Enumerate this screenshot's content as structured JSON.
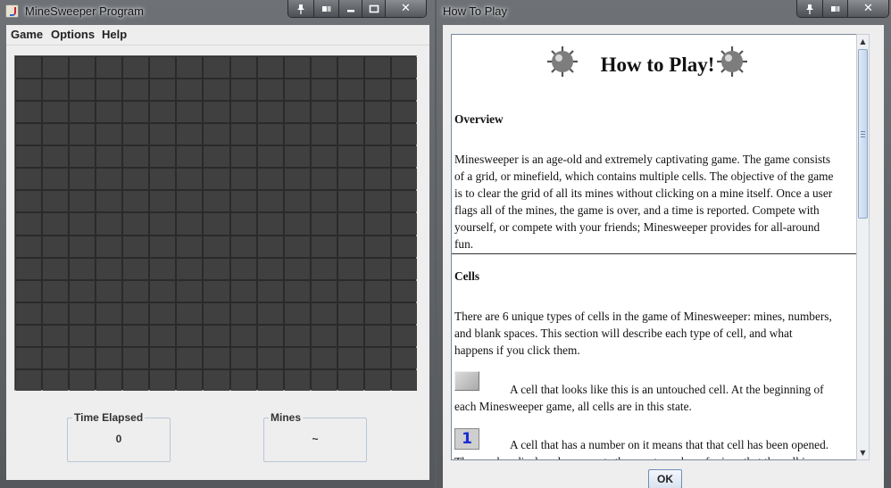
{
  "minesweeper_window": {
    "title": "MineSweeper Program",
    "menu": [
      "Game",
      "Options",
      "Help"
    ],
    "board": {
      "rows": 15,
      "cols": 15
    },
    "time_elapsed": {
      "label": "Time Elapsed",
      "value": "0"
    },
    "mines": {
      "label": "Mines",
      "value": "~"
    }
  },
  "howto_window": {
    "title": "How To Play",
    "heading": "How to Play!",
    "sections": {
      "overview_title": "Overview",
      "overview_lines": [
        "Minesweeper is an age-old and extremely captivating game. The game consists",
        "of a grid, or minefield, which contains multiple cells. The objective of the game",
        "is to clear the grid of all its mines without clicking on a mine itself. Once a user",
        "flags all of the mines, the game is over, and a time is reported. Compete with",
        "yourself, or compete with your friends; Minesweeper provides for all-around",
        "fun."
      ],
      "cells_title": "Cells",
      "cells_lines": [
        "There are 6 unique types of cells in the game of Minesweeper: mines, numbers,",
        "and blank spaces. This section will describe each type of cell, and what",
        "happens if you click them."
      ],
      "untouched_lines": [
        "A cell that looks like this is an untouched cell. At the beginning of",
        "each Minesweeper game, all cells are in this state."
      ],
      "number_icon": "1",
      "number_lines": [
        "A cell that has a number on it means that that cell has been opened.",
        "The number displayed represents the exact number of mines that the cell is"
      ]
    },
    "ok_label": "OK"
  },
  "window_controls": {
    "pin_icon": "pin-icon",
    "restore_icon": "restore-down-icon",
    "minimize_icon": "minimize-icon",
    "maximize_icon": "maximize-icon",
    "close_icon": "close-icon"
  },
  "colors": {
    "cell": "#404040",
    "board_bg": "#2a2a2a",
    "number_one": "#1b2bd6",
    "titlebar": "#6e7175"
  }
}
